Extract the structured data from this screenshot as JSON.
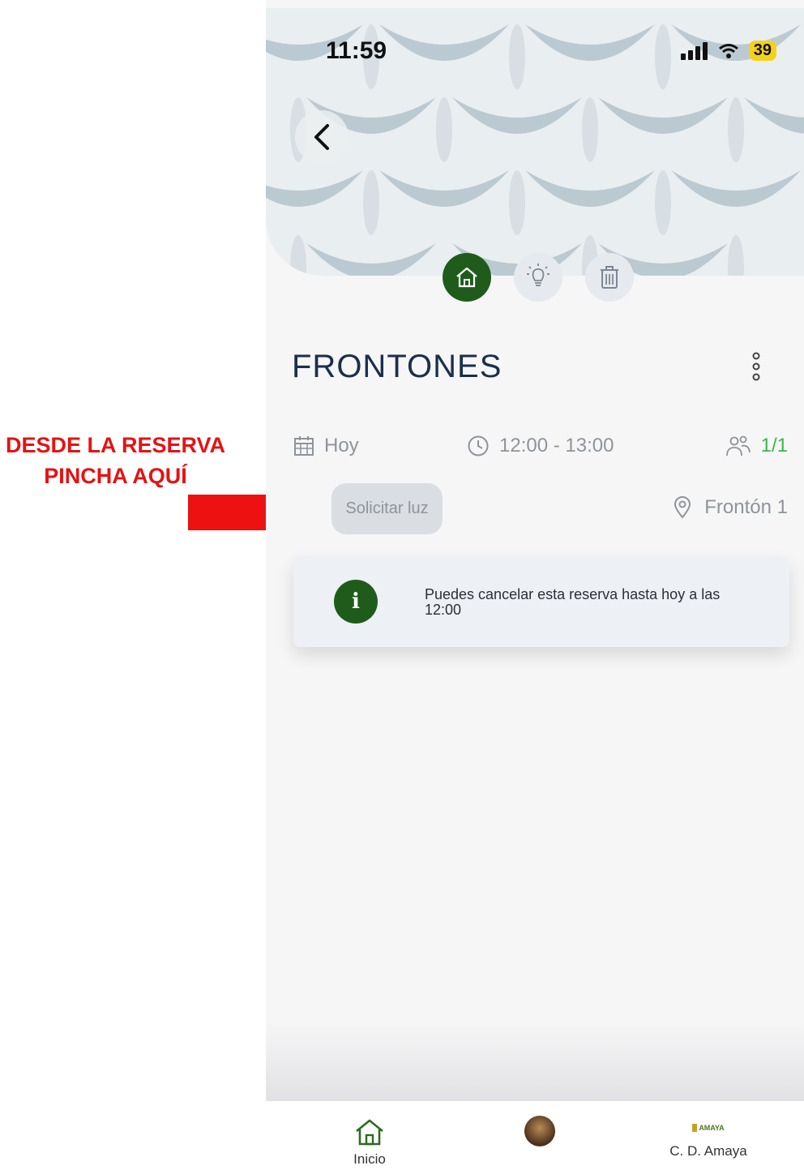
{
  "annotation": {
    "line1": "DESDE LA RESERVA",
    "line2": "PINCHA AQUÍ",
    "color": "#e41313"
  },
  "status_bar": {
    "time": "11:59",
    "battery": "39"
  },
  "header": {
    "back_icon": "chevron-left-icon"
  },
  "actions": [
    {
      "icon": "home-icon",
      "active": true
    },
    {
      "icon": "lightbulb-icon",
      "active": false
    },
    {
      "icon": "trash-icon",
      "active": false
    }
  ],
  "booking": {
    "title": "FRONTONES",
    "date": "Hoy",
    "time_range": "12:00 - 13:00",
    "participants": "1/1",
    "request_light_label": "Solicitar luz",
    "court": "Frontón 1"
  },
  "notice": {
    "icon_letter": "i",
    "text": "Puedes cancelar esta reserva hasta hoy a las 12:00"
  },
  "tabbar": {
    "items": [
      {
        "label": "Inicio",
        "icon": "home-icon"
      },
      {
        "label": "",
        "icon": "avatar"
      },
      {
        "label": "C. D. Amaya",
        "icon": "club-logo",
        "logo_text": "AMAYA"
      }
    ]
  },
  "colors": {
    "brand_green": "#1f5c1c",
    "participants_green": "#3bb84a",
    "title_navy": "#1b2f4a"
  }
}
